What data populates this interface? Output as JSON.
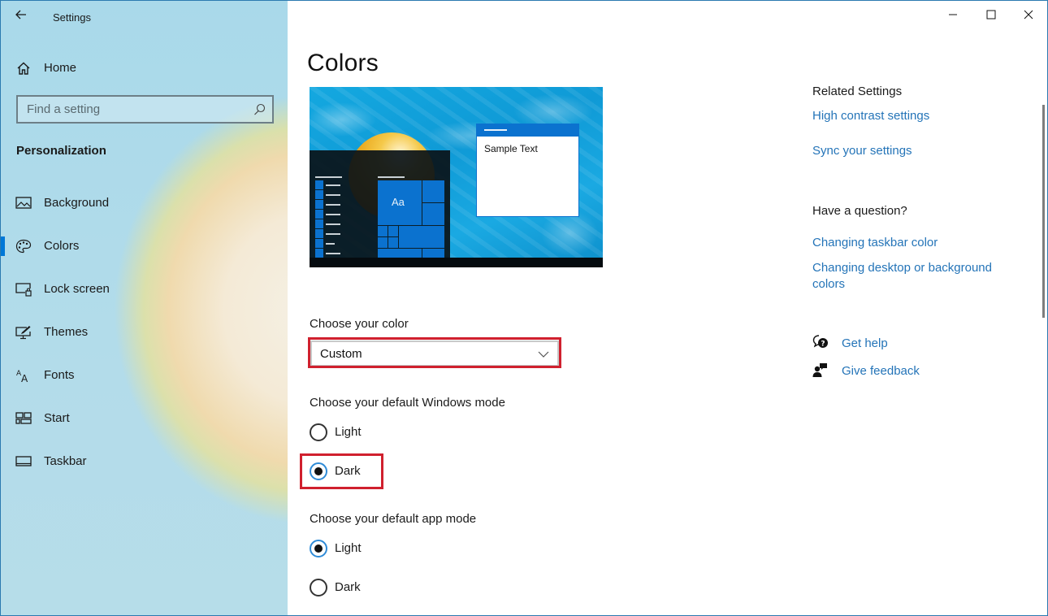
{
  "window": {
    "title": "Settings",
    "controls": {
      "minimize": "minimize",
      "maximize": "maximize",
      "close": "close"
    }
  },
  "sidebar": {
    "home_label": "Home",
    "search": {
      "placeholder": "Find a setting",
      "value": ""
    },
    "section_label": "Personalization",
    "items": [
      {
        "label": "Background",
        "icon": "picture-icon",
        "selected": false
      },
      {
        "label": "Colors",
        "icon": "palette-icon",
        "selected": true
      },
      {
        "label": "Lock screen",
        "icon": "lock-screen-icon",
        "selected": false
      },
      {
        "label": "Themes",
        "icon": "themes-icon",
        "selected": false
      },
      {
        "label": "Fonts",
        "icon": "fonts-icon",
        "selected": false
      },
      {
        "label": "Start",
        "icon": "start-icon",
        "selected": false
      },
      {
        "label": "Taskbar",
        "icon": "taskbar-icon",
        "selected": false
      }
    ]
  },
  "main": {
    "page_title": "Colors",
    "preview": {
      "sample_text": "Sample Text",
      "tile_label": "Aa",
      "accent_color": "#0b72cf"
    },
    "choose_color": {
      "label": "Choose your color",
      "selected": "Custom"
    },
    "windows_mode": {
      "label": "Choose your default Windows mode",
      "options": [
        {
          "label": "Light",
          "checked": false
        },
        {
          "label": "Dark",
          "checked": true
        }
      ]
    },
    "app_mode": {
      "label": "Choose your default app mode",
      "options": [
        {
          "label": "Light",
          "checked": true
        },
        {
          "label": "Dark",
          "checked": false
        }
      ]
    },
    "highlight_color": "#d0202e"
  },
  "related": {
    "heading": "Related Settings",
    "links": [
      "High contrast settings",
      "Sync your settings"
    ],
    "question_heading": "Have a question?",
    "question_links": [
      "Changing taskbar color",
      "Changing desktop or background colors"
    ],
    "help": [
      {
        "label": "Get help",
        "icon": "get-help-icon"
      },
      {
        "label": "Give feedback",
        "icon": "feedback-icon"
      }
    ],
    "link_color": "#2474b8"
  }
}
